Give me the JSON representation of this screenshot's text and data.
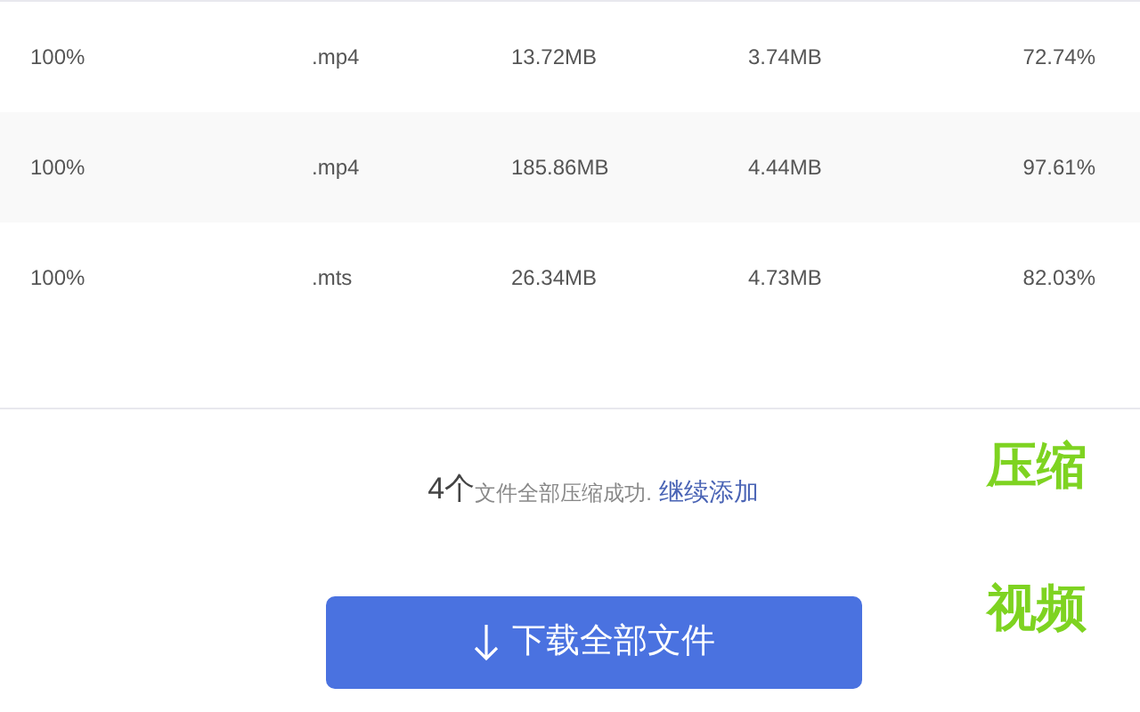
{
  "table": {
    "rows": [
      {
        "cells": [
          "100%",
          ".mp4",
          "13.72MB",
          "3.74MB",
          "72.74%"
        ]
      },
      {
        "cells": [
          "100%",
          ".mp4",
          "185.86MB",
          "4.44MB",
          "97.61%"
        ]
      },
      {
        "cells": [
          "100%",
          ".mts",
          "26.34MB",
          "4.73MB",
          "82.03%"
        ]
      }
    ]
  },
  "status": {
    "count": "4个",
    "message": "文件全部压缩成功.",
    "link": "继续添加"
  },
  "download_button": {
    "label": "下载全部文件"
  },
  "captions": [
    "压缩",
    "视频"
  ]
}
